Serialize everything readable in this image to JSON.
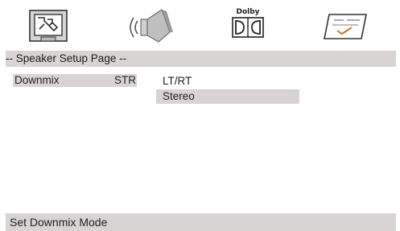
{
  "icons": [
    {
      "name": "general-setup-icon",
      "label": ""
    },
    {
      "name": "speaker-icon",
      "label": ""
    },
    {
      "name": "dolby-icon",
      "label": "Dolby"
    },
    {
      "name": "preference-icon",
      "label": ""
    }
  ],
  "page": {
    "title": "-- Speaker Setup Page --"
  },
  "menu": {
    "items": [
      {
        "label": "Downmix",
        "value": "STR"
      }
    ],
    "options": [
      {
        "label": "LT/RT",
        "selected": false
      },
      {
        "label": "Stereo",
        "selected": true
      }
    ]
  },
  "status": {
    "text": "Set Downmix Mode"
  },
  "colors": {
    "highlight": "#d9d4d4",
    "background": "#ffffff",
    "text": "#222222"
  }
}
